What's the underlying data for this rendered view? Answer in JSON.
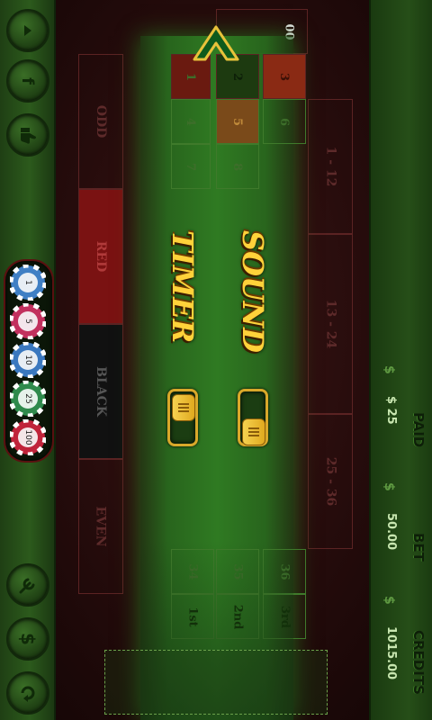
{
  "game": {
    "outside_bets": [
      "ODD",
      "RED",
      "BLACK",
      "EVEN"
    ],
    "dozens": [
      "1 - 12",
      "13 - 24",
      "25 - 36"
    ],
    "numbers_row1": [
      "1",
      "4",
      "7"
    ],
    "numbers_row2": [
      "2",
      "5",
      "8"
    ],
    "numbers_row3": [
      "3",
      "6"
    ],
    "zero": "00",
    "column_bets": [
      "1st",
      "2nd",
      "3rd"
    ],
    "column_numbers": [
      "34",
      "35",
      "36"
    ]
  },
  "settings": {
    "sound_label": "SOUND",
    "timer_label": "TIMER",
    "sound_on": true,
    "timer_on": true
  },
  "chips": [
    "1",
    "5",
    "10",
    "25",
    "100"
  ],
  "status": {
    "paid_label": "PAID",
    "paid_value": "$ 25",
    "bet_label": "BET",
    "bet_value": "50.00",
    "credits_label": "CREDITS",
    "credits_value": "1015.00",
    "currency_symbol": "$"
  },
  "icons": [
    "back-arrow-icon",
    "facebook-icon",
    "thumbs-up-icon",
    "wrench-icon",
    "dollar-icon",
    "repeat-icon"
  ],
  "colors": {
    "accent": "#ffd23a",
    "felt": "#2f7a22",
    "red_cell": "#7a1212",
    "black_cell": "#111111"
  }
}
